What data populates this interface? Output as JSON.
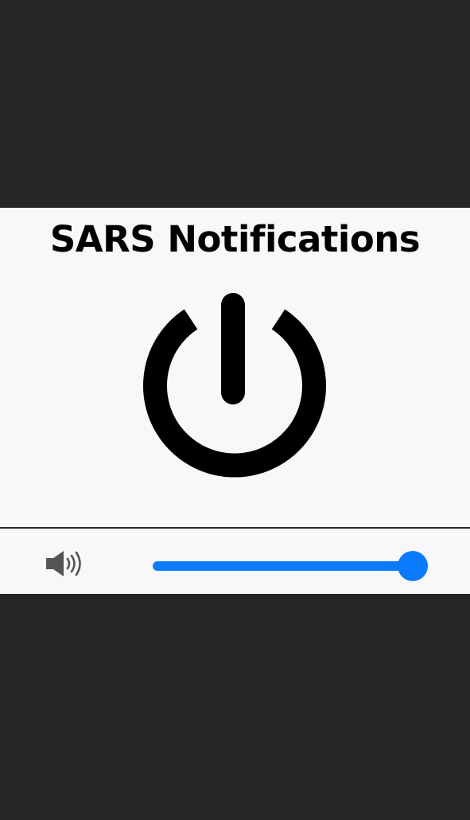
{
  "app": {
    "title": "SARS Notifications"
  },
  "power": {
    "icon": "power-icon",
    "color": "#000000"
  },
  "volume": {
    "icon": "speaker-icon",
    "level_percent": 100,
    "accent_color": "#0a7bff"
  },
  "colors": {
    "background": "#252525",
    "panel": "#f8f8fa",
    "divider": "#2a2a2a"
  }
}
